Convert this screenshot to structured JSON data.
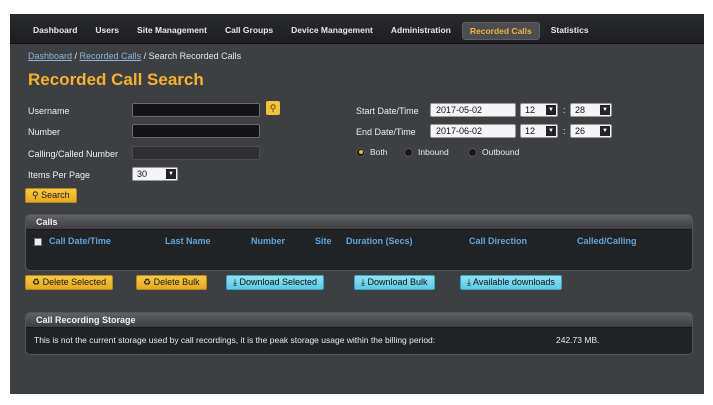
{
  "nav": {
    "items": [
      {
        "label": "Dashboard"
      },
      {
        "label": "Users"
      },
      {
        "label": "Site Management"
      },
      {
        "label": "Call Groups"
      },
      {
        "label": "Device Management"
      },
      {
        "label": "Administration"
      },
      {
        "label": "Recorded Calls",
        "active": true
      },
      {
        "label": "Statistics"
      }
    ]
  },
  "breadcrumb": {
    "dashboard": "Dashboard",
    "sep1": " / ",
    "recorded_calls": "Recorded Calls",
    "sep2": " / ",
    "current": "Search Recorded Calls"
  },
  "page_title": "Recorded Call Search",
  "form": {
    "username_label": "Username",
    "username_value": "",
    "number_label": "Number",
    "number_value": "",
    "calling_called_label": "Calling/Called Number",
    "calling_called_value": "",
    "items_per_page_label": "Items Per Page",
    "items_per_page_value": "30",
    "start_label": "Start Date/Time",
    "start_date": "2017-05-02",
    "start_hour": "12",
    "start_minute": "28",
    "end_label": "End Date/Time",
    "end_date": "2017-06-02",
    "end_hour": "12",
    "end_minute": "26",
    "colon": ":",
    "direction_options": [
      {
        "label": "Both",
        "selected": true
      },
      {
        "label": "Inbound",
        "selected": false
      },
      {
        "label": "Outbound",
        "selected": false
      }
    ],
    "search_label": "Search"
  },
  "calls_panel": {
    "title": "Calls",
    "columns": [
      "Call Date/Time",
      "Last Name",
      "Number",
      "Site",
      "Duration (Secs)",
      "Call Direction",
      "Called/Calling"
    ]
  },
  "actions": {
    "delete_selected": "Delete Selected",
    "delete_bulk": "Delete Bulk",
    "download_selected": "Download Selected",
    "download_bulk": "Download Bulk",
    "available_downloads": "Available downloads"
  },
  "storage_panel": {
    "title": "Call Recording Storage",
    "note": "This is not the current storage used by call recordings, it is the peak storage usage within the billing period:",
    "value": "242.73 MB."
  },
  "colors": {
    "accent": "#f4b230",
    "link": "#5ea6de",
    "download_button": "#8fe2f2"
  }
}
